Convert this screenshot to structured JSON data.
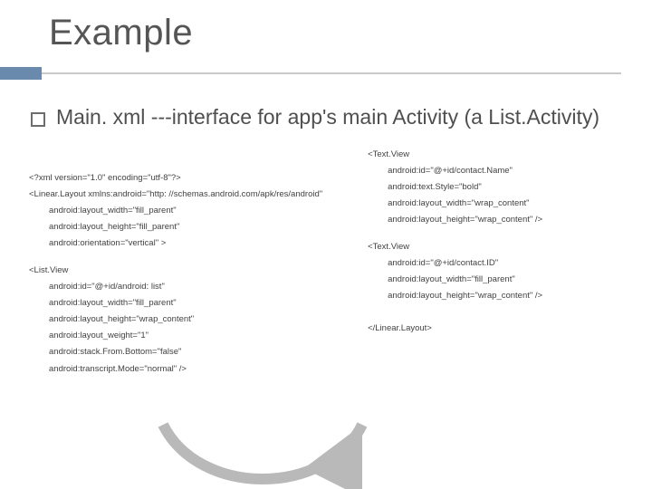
{
  "title": "Example",
  "bullet": "Main. xml ---interface for app's main Activity (a List.Activity)",
  "left": {
    "l1": "<?xml version=\"1.0\" encoding=\"utf-8\"?>",
    "l2": "<Linear.Layout xmlns:android=\"http: //schemas.android.com/apk/res/android\"",
    "l3": "android:layout_width=\"fill_parent\"",
    "l4": "android:layout_height=\"fill_parent\"",
    "l5": "android:orientation=\"vertical\" >",
    "l6": "<List.View",
    "l7": "android:id=\"@+id/android: list\"",
    "l8": "android:layout_width=\"fill_parent\"",
    "l9": "android:layout_height=\"wrap_content\"",
    "l10": "android:layout_weight=\"1\"",
    "l11": "android:stack.From.Bottom=\"false\"",
    "l12": "android:transcript.Mode=\"normal\" />"
  },
  "right": {
    "r1": "<Text.View",
    "r2": "android:id=\"@+id/contact.Name\"",
    "r3": "android:text.Style=\"bold\"",
    "r4": "android:layout_width=\"wrap_content\"",
    "r5": "android:layout_height=\"wrap_content\" />",
    "r6": "<Text.View",
    "r7": "android:id=\"@+id/contact.ID\"",
    "r8": "android:layout_width=\"fill_parent\"",
    "r9": "android:layout_height=\"wrap_content\" />",
    "r10": "</Linear.Layout>"
  }
}
